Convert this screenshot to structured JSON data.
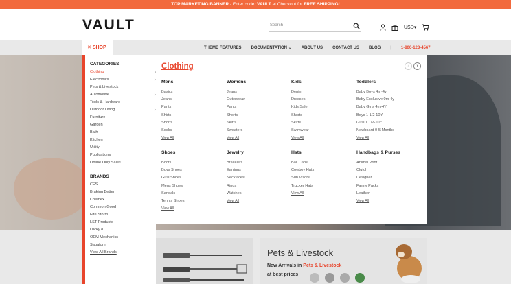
{
  "banner": {
    "lead": "TOP MARKETING BANNER",
    "mid": " - Enter code: ",
    "code": "VAULT",
    "mid2": " at Checkout for ",
    "offer": "FREE SHIPPING!"
  },
  "header": {
    "logo": "VAULT",
    "search_placeholder": "Search",
    "currency": "USD"
  },
  "nav": {
    "shop_label": "SHOP",
    "links": [
      "THEME FEATURES",
      "DOCUMENTATION",
      "ABOUT US",
      "CONTACT US",
      "BLOG"
    ],
    "phone": "1-800-123-4567"
  },
  "sidebar": {
    "categories_title": "CATEGORIES",
    "categories": [
      {
        "label": "Clothing",
        "arrow": true
      },
      {
        "label": "Electronics",
        "arrow": true
      },
      {
        "label": "Pets & Livestock",
        "arrow": false
      },
      {
        "label": "Automotive",
        "arrow": true
      },
      {
        "label": "Tools & Hardware",
        "arrow": false
      },
      {
        "label": "Outdoor Living",
        "arrow": true
      },
      {
        "label": "Furniture",
        "arrow": false
      },
      {
        "label": "Garden",
        "arrow": false
      },
      {
        "label": "Bath",
        "arrow": false
      },
      {
        "label": "Kitchen",
        "arrow": false
      },
      {
        "label": "Utility",
        "arrow": false
      },
      {
        "label": "Publications",
        "arrow": false
      },
      {
        "label": "Online Only Sales",
        "arrow": false
      }
    ],
    "brands_title": "BRANDS",
    "brands": [
      "CFS",
      "Braking Better",
      "Chemex",
      "Common Good",
      "Fire Storm",
      "LST Products",
      "Lucky 8",
      "OEM Mechanics",
      "Sagaform"
    ],
    "view_all_brands": "View All Brands"
  },
  "mega": {
    "title": "Clothing",
    "columns_row1": [
      {
        "heading": "Mens",
        "items": [
          "Basics",
          "Jeans",
          "Pants",
          "Shirts",
          "Shorts",
          "Socks"
        ]
      },
      {
        "heading": "Womens",
        "items": [
          "Jeans",
          "Outerwear",
          "Pants",
          "Shorts",
          "Skirts",
          "Sweaters"
        ]
      },
      {
        "heading": "Kids",
        "items": [
          "Denim",
          "Dresses",
          "Kids Sale",
          "Shorts",
          "Skirts",
          "Swimwear"
        ]
      },
      {
        "heading": "Toddlers",
        "items": [
          "Baby Boys 4m-4y",
          "Baby Exclusive 0m-4y",
          "Baby Girls 4m-4Y",
          "Boys 1 1/2-10Y",
          "Girls 1 1/2-10Y",
          "Newboard 0-5 Months"
        ]
      }
    ],
    "columns_row2": [
      {
        "heading": "Shoes",
        "items": [
          "Boots",
          "Boys Shoes",
          "Girls Shoes",
          "Mens Shoes",
          "Sandals",
          "Tennis Shoes"
        ]
      },
      {
        "heading": "Jewelry",
        "items": [
          "Bracelets",
          "Earrings",
          "Necklaces",
          "Rings",
          "Watches"
        ]
      },
      {
        "heading": "Hats",
        "items": [
          "Ball Caps",
          "Cowboy Hats",
          "Sun Visors",
          "Trucker Hats"
        ]
      },
      {
        "heading": "Handbags & Purses",
        "items": [
          "Animal Print",
          "Clutch",
          "Designer",
          "Fanny Packs",
          "Leather"
        ]
      }
    ],
    "view_all": "View All"
  },
  "promo": {
    "title": "Pets & Livestock",
    "line1_a": "New Arrivals",
    "line1_b": " in ",
    "line1_c": "Pets & Livestock",
    "line2": "at best prices"
  },
  "colors": {
    "accent": "#e8452c",
    "banner": "#f26a3d",
    "nav_bg": "#e9e9e9"
  }
}
